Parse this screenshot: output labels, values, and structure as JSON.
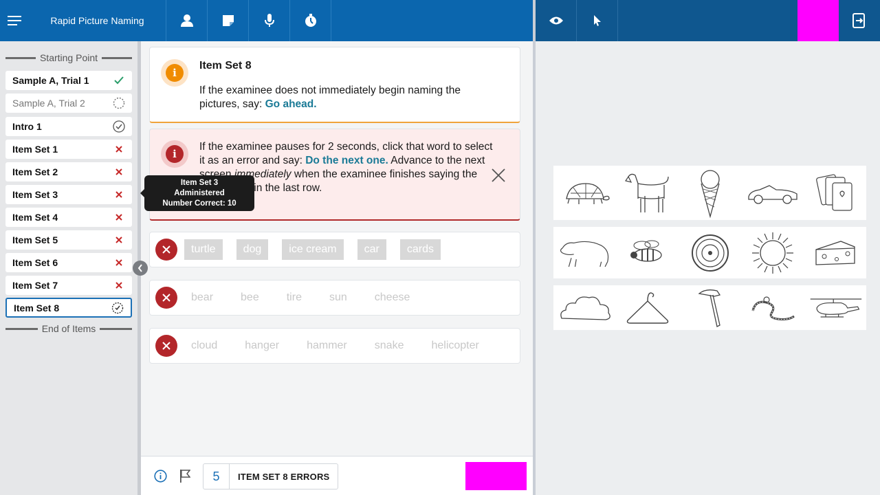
{
  "header": {
    "title": "Rapid Picture Naming"
  },
  "icons": {
    "menu": "menu-icon",
    "person": "person-icon",
    "note": "note-icon",
    "mic": "microphone-icon",
    "timer": "timer-icon",
    "eye": "eye-icon",
    "pointer": "pointer-icon",
    "exit": "exit-icon"
  },
  "sidebar": {
    "start_label": "Starting Point",
    "end_label": "End of Items",
    "items": [
      {
        "label": "Sample A, Trial 1",
        "status": "correct"
      },
      {
        "label": "Sample A, Trial 2",
        "status": "pending"
      },
      {
        "label": "Intro 1",
        "status": "done"
      },
      {
        "label": "Item Set 1",
        "status": "error"
      },
      {
        "label": "Item Set 2",
        "status": "error"
      },
      {
        "label": "Item Set 3",
        "status": "error"
      },
      {
        "label": "Item Set 4",
        "status": "error"
      },
      {
        "label": "Item Set 5",
        "status": "error"
      },
      {
        "label": "Item Set 6",
        "status": "error"
      },
      {
        "label": "Item Set 7",
        "status": "error"
      },
      {
        "label": "Item Set 8",
        "status": "in-progress"
      }
    ]
  },
  "tooltip": {
    "line1": "Item Set 3",
    "line2": "Administered",
    "line3": "Number Correct: 10"
  },
  "info_card": {
    "title": "Item Set 8",
    "text": "If the examinee does not immediately begin naming the pictures, say: ",
    "say": "Go ahead."
  },
  "alert_card": {
    "text1": "If the examinee pauses for 2 seconds, click that word to select it as an error and say: ",
    "say": "Do the next one.",
    "text2": "Advance to the next screen ",
    "emph": "immediately",
    "text3": " when the examinee finishes saying the last picture in the last row."
  },
  "rows": [
    {
      "words": [
        "turtle",
        "dog",
        "ice cream",
        "car",
        "cards"
      ],
      "selected": true
    },
    {
      "words": [
        "bear",
        "bee",
        "tire",
        "sun",
        "cheese"
      ],
      "selected": false
    },
    {
      "words": [
        "cloud",
        "hanger",
        "hammer",
        "snake",
        "helicopter"
      ],
      "selected": false
    }
  ],
  "footer": {
    "count": "5",
    "label": "ITEM SET 8 ERRORS"
  },
  "colors": {
    "brand": "#0b66ae",
    "error": "#b3262a",
    "correct": "#2a9d6a",
    "accent_say": "#1a7a96",
    "placeholder": "#ff00ff"
  }
}
